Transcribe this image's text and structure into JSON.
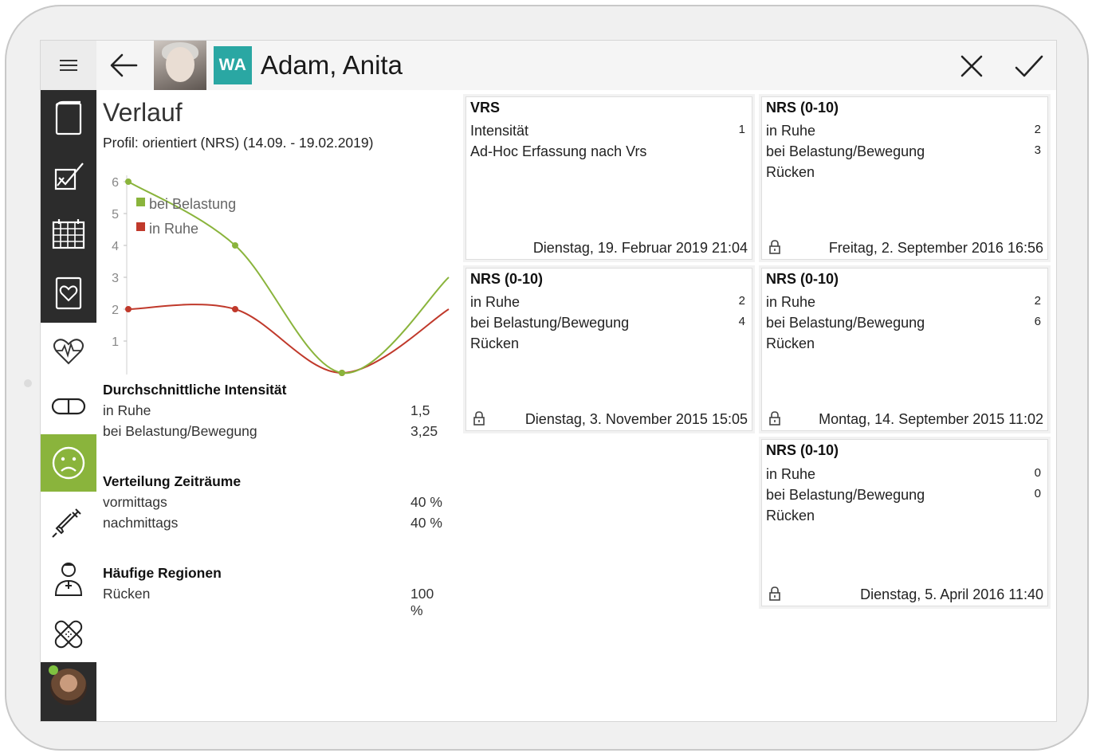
{
  "header": {
    "patient_badge": "WA",
    "patient_name": "Adam, Anita"
  },
  "sidebar": {
    "items": [
      {
        "icon": "book-icon"
      },
      {
        "icon": "checklist-icon"
      },
      {
        "icon": "calendar-icon"
      },
      {
        "icon": "heart-document-icon"
      },
      {
        "icon": "heartbeat-icon"
      },
      {
        "icon": "pill-icon"
      },
      {
        "icon": "sad-face-icon",
        "active": true
      },
      {
        "icon": "syringe-icon"
      },
      {
        "icon": "doctor-icon"
      },
      {
        "icon": "bandage-icon"
      }
    ]
  },
  "left_panel": {
    "title": "Verlauf",
    "profil": "Profil:  orientiert (NRS)   (14.09. - 19.02.2019)",
    "stats": [
      {
        "heading": "Durchschnittliche Intensität",
        "rows": [
          {
            "label": "in Ruhe",
            "value": "1,5"
          },
          {
            "label": "bei Belastung/Bewegung",
            "value": "3,25"
          }
        ]
      },
      {
        "heading": "Verteilung Zeiträume",
        "rows": [
          {
            "label": "vormittags",
            "value": "40 %"
          },
          {
            "label": "nachmittags",
            "value": "40 %"
          }
        ]
      },
      {
        "heading": "Häufige Regionen",
        "rows": [
          {
            "label": "Rücken",
            "value": "100 %"
          }
        ]
      }
    ]
  },
  "chart_data": {
    "type": "line",
    "x": [
      0,
      1,
      2,
      3
    ],
    "ylim": [
      0,
      6
    ],
    "yticks": [
      "1",
      "2",
      "3",
      "4",
      "5",
      "6"
    ],
    "series": [
      {
        "name": "bei Belastung",
        "color": "#8ab43c",
        "values": [
          6,
          4,
          0,
          3
        ]
      },
      {
        "name": "in Ruhe",
        "color": "#c0392b",
        "values": [
          2,
          2,
          0,
          2
        ]
      }
    ]
  },
  "cards": [
    {
      "title": "VRS",
      "rows": [
        {
          "label": "Intensität",
          "value": "1"
        },
        {
          "label": "Ad-Hoc Erfassung nach Vrs",
          "value": ""
        }
      ],
      "footer": "Dienstag, 19. Februar 2019 21:04",
      "locked": false
    },
    {
      "title": "NRS (0-10)",
      "rows": [
        {
          "label": "in Ruhe",
          "value": "2"
        },
        {
          "label": "bei Belastung/Bewegung",
          "value": "3"
        },
        {
          "label": "Rücken",
          "value": ""
        }
      ],
      "footer": "Freitag, 2. September 2016 16:56",
      "locked": true
    },
    {
      "title": "NRS (0-10)",
      "rows": [
        {
          "label": "in Ruhe",
          "value": "2"
        },
        {
          "label": "bei Belastung/Bewegung",
          "value": "4"
        },
        {
          "label": "Rücken",
          "value": ""
        }
      ],
      "footer": "Dienstag, 3. November 2015 15:05",
      "locked": true
    },
    {
      "title": "NRS (0-10)",
      "rows": [
        {
          "label": "in Ruhe",
          "value": "2"
        },
        {
          "label": "bei Belastung/Bewegung",
          "value": "6"
        },
        {
          "label": "Rücken",
          "value": ""
        }
      ],
      "footer": "Montag, 14. September 2015 11:02",
      "locked": true
    },
    {
      "title": "NRS (0-10)",
      "rows": [
        {
          "label": "in Ruhe",
          "value": "0"
        },
        {
          "label": "bei Belastung/Bewegung",
          "value": "0"
        },
        {
          "label": "Rücken",
          "value": ""
        }
      ],
      "footer": "Dienstag, 5. April 2016 11:40",
      "locked": true
    }
  ]
}
